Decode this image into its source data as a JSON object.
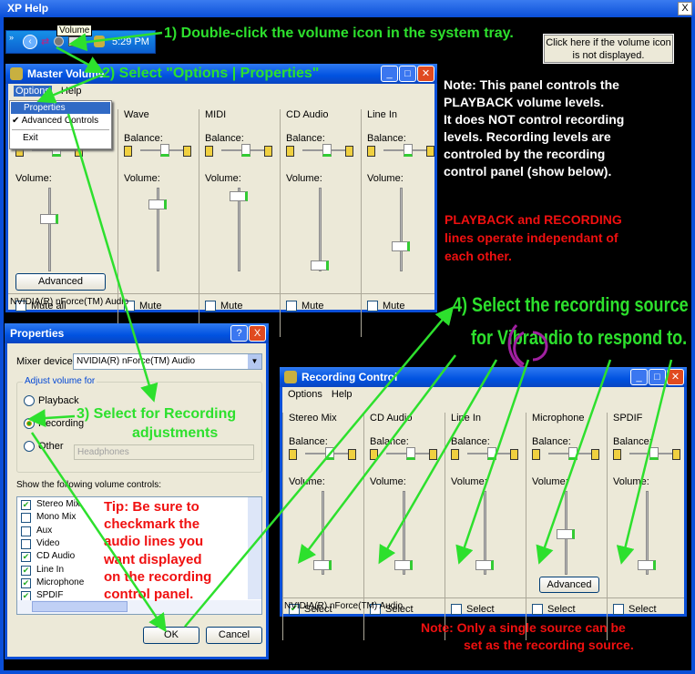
{
  "window": {
    "title": "XP Help",
    "close": "X"
  },
  "tray": {
    "tooltip": "Volume",
    "time": "5:29 PM",
    "chevron": "»"
  },
  "help_button": {
    "line1": "Click here if the volume icon",
    "line2": "is not displayed."
  },
  "annotations": {
    "step1": "1) Double-click the volume icon in the system tray.",
    "step2": "2) Select \"Options | Properties\"",
    "step3_line1": "3) Select for Recording",
    "step3_line2": "adjustments",
    "step4_line1": "4) Select the recording source",
    "step4_line2": "for Vibraudio to respond to.",
    "note_playback": [
      "Note: This panel controls the",
      "PLAYBACK volume levels.",
      "It does NOT control recording",
      "levels.  Recording levels are",
      "controled by the recording",
      "control panel (show below)."
    ],
    "note_independent": [
      "PLAYBACK and RECORDING",
      "lines operate independant of",
      "each other."
    ],
    "tip": [
      "Tip: Be sure to",
      "checkmark the",
      "audio lines you",
      "want displayed",
      "on the recording",
      "control panel."
    ],
    "note_single": [
      "Note: Only a single source can be",
      "set as the recording source."
    ]
  },
  "master": {
    "title": "Master Volume",
    "menu": [
      "Options",
      "Help"
    ],
    "dropdown": [
      {
        "label": "Properties",
        "highlighted": true
      },
      {
        "label": "Advanced Controls",
        "checked": true
      },
      {
        "label": "Exit"
      }
    ],
    "balance_label": "Balance:",
    "volume_label": "Volume:",
    "columns": [
      {
        "name": "",
        "check": "Mute all",
        "checked": false,
        "volume": 0.65
      },
      {
        "name": "Wave",
        "check": "Mute",
        "checked": false,
        "volume": 0.85
      },
      {
        "name": "MIDI",
        "check": "Mute",
        "checked": false,
        "volume": 0.95
      },
      {
        "name": "CD Audio",
        "check": "Mute",
        "checked": false,
        "volume": 0.05
      },
      {
        "name": "Line In",
        "check": "Mute",
        "checked": false,
        "volume": 0.3
      }
    ],
    "advanced": "Advanced",
    "status": "NVIDIA(R) nForce(TM) Audio"
  },
  "properties": {
    "title": "Properties",
    "help": "?",
    "close": "X",
    "mixer_label": "Mixer device:",
    "mixer_value": "NVIDIA(R) nForce(TM) Audio",
    "group_label": "Adjust volume for",
    "radios": [
      {
        "label": "Playback",
        "selected": false
      },
      {
        "label": "Recording",
        "selected": true
      },
      {
        "label": "Other",
        "selected": false
      }
    ],
    "other_value": "Headphones",
    "list_label": "Show the following volume controls:",
    "controls": [
      {
        "label": "Stereo Mix",
        "checked": true
      },
      {
        "label": "Mono Mix",
        "checked": false
      },
      {
        "label": "Aux",
        "checked": false
      },
      {
        "label": "Video",
        "checked": false
      },
      {
        "label": "CD Audio",
        "checked": true
      },
      {
        "label": "Line In",
        "checked": true
      },
      {
        "label": "Microphone",
        "checked": true
      },
      {
        "label": "SPDIF",
        "checked": true
      }
    ],
    "ok": "OK",
    "cancel": "Cancel"
  },
  "recording": {
    "title": "Recording Control",
    "menu": [
      "Options",
      "Help"
    ],
    "balance_label": "Balance:",
    "volume_label": "Volume:",
    "columns": [
      {
        "name": "Stereo Mix",
        "check": "Select",
        "checked": true,
        "volume": 0.1
      },
      {
        "name": "CD Audio",
        "check": "Select",
        "checked": false,
        "volume": 0.1
      },
      {
        "name": "Line In",
        "check": "Select",
        "checked": false,
        "volume": 0.1
      },
      {
        "name": "Microphone",
        "check": "Select",
        "checked": false,
        "volume": 0.5
      },
      {
        "name": "SPDIF",
        "check": "Select",
        "checked": false,
        "volume": 0.1
      }
    ],
    "advanced": "Advanced",
    "status": "NVIDIA(R) nForce(TM) Audio"
  },
  "colors": {
    "annotation_green": "#2de02d",
    "annotation_red": "#f01010",
    "xp_blue": "#0a4fd8",
    "dialog_bg": "#ece9d8"
  }
}
